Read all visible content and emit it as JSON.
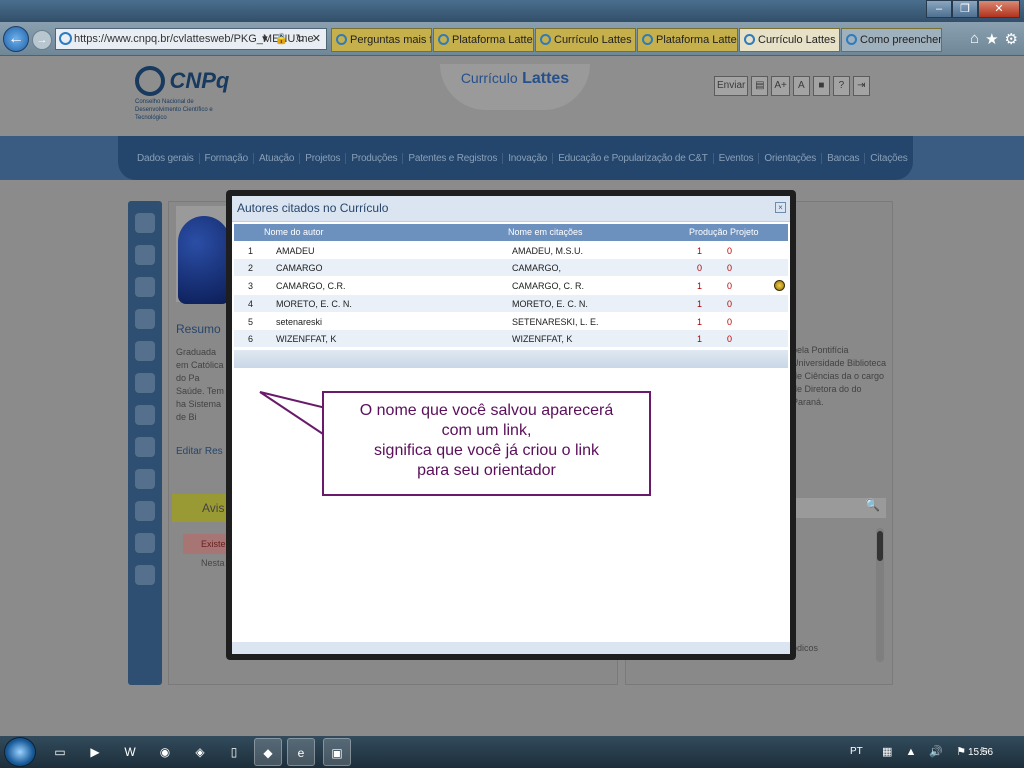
{
  "browser": {
    "address": "https://www.cnpq.br/cvlattesweb/PKG_MENU.me",
    "address_icons": "▾ 🔒 ↻ ✕",
    "tabs": [
      {
        "label": "Perguntas mais fre...",
        "state": "normal"
      },
      {
        "label": "Plataforma Lattes",
        "state": "normal"
      },
      {
        "label": "Currículo Lattes",
        "state": "normal"
      },
      {
        "label": "Plataforma Lattes",
        "state": "normal"
      },
      {
        "label": "Currículo Lattes",
        "state": "active"
      },
      {
        "label": "Como preencher ...",
        "state": "gray"
      }
    ],
    "toolbar_icons": [
      "home-icon",
      "star-icon",
      "gear-icon"
    ]
  },
  "header": {
    "logo_text": "CNPq",
    "logo_subtitle": "Conselho Nacional de Desenvolvimento Científico e Tecnológico",
    "curriculo_label": "Currículo",
    "lattes_label": "Lattes",
    "enviar_label": "Enviar",
    "tool_buttons": [
      "A+",
      "A",
      "■",
      "?",
      "⇥"
    ]
  },
  "nav": {
    "items": [
      "Dados gerais",
      "Formação",
      "Atuação",
      "Projetos",
      "Produções",
      "Patentes e Registros",
      "Inovação",
      "Educação e Popularização de C&T",
      "Eventos",
      "Orientações",
      "Bancas",
      "Citações"
    ]
  },
  "background": {
    "resumo_label": "Resumo",
    "left_text": "Graduada em Católica do Pa Saúde. Tem ha Sistema de Bi",
    "right_text": "pela Pontifícia Universidade Biblioteca de Ciências da o cargo de Diretora do do Paraná.",
    "editar_label": "Editar Res",
    "aviso_label": "Avis",
    "existem_label": "Existem",
    "nesta_label": "Nesta a",
    "dicos_label": "ódicos"
  },
  "modal": {
    "title": "Autores citados no Currículo",
    "close_label": "×",
    "columns": {
      "author": "Nome do autor",
      "citation": "Nome em citações",
      "production": "Produção",
      "project": "Projeto"
    },
    "rows": [
      {
        "num": "1",
        "name": "AMADEU",
        "citation": "AMADEU, M.S.U.",
        "production": "1",
        "project": "0",
        "linked": false
      },
      {
        "num": "2",
        "name": "CAMARGO",
        "citation": "CAMARGO,",
        "production": "0",
        "project": "0",
        "linked": false
      },
      {
        "num": "3",
        "name": "CAMARGO, C.R.",
        "citation": "CAMARGO, C. R.",
        "production": "1",
        "project": "0",
        "linked": true
      },
      {
        "num": "4",
        "name": "MORETO, E. C. N.",
        "citation": "MORETO, E. C. N.",
        "production": "1",
        "project": "0",
        "linked": false
      },
      {
        "num": "5",
        "name": "setenareski",
        "citation": "SETENARESKI, L. E.",
        "production": "1",
        "project": "0",
        "linked": false
      },
      {
        "num": "6",
        "name": "WIZENFFAT, K",
        "citation": "WIZENFFAT, K",
        "production": "1",
        "project": "0",
        "linked": false
      }
    ]
  },
  "callout": {
    "line1": "O nome que você salvou aparecerá",
    "line2": "com um link,",
    "line3": "significa que você já criou o link",
    "line4": "para seu orientador"
  },
  "taskbar": {
    "lang": "PT",
    "time": "15:56",
    "tray_icons": "▦ ▲ 🔊 ⚑ ⚐"
  },
  "colors": {
    "nav_bar": "#24466c",
    "modal_header": "#6d91bf",
    "callout_border": "#6a1a6a",
    "callout_text": "#5b0f5b",
    "count_red": "#b00000"
  }
}
